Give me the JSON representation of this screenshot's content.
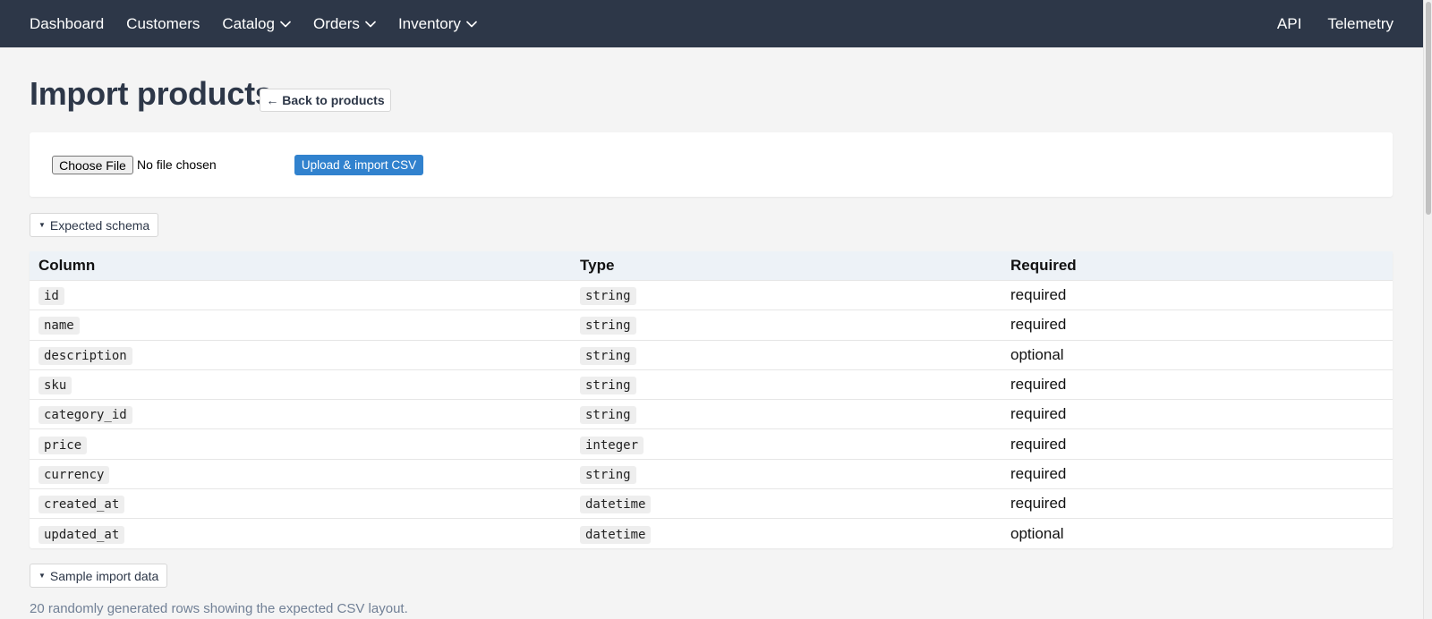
{
  "nav": {
    "left": [
      {
        "label": "Dashboard",
        "dropdown": false
      },
      {
        "label": "Customers",
        "dropdown": false
      },
      {
        "label": "Catalog",
        "dropdown": true
      },
      {
        "label": "Orders",
        "dropdown": true
      },
      {
        "label": "Inventory",
        "dropdown": true
      }
    ],
    "right": [
      {
        "label": "API"
      },
      {
        "label": "Telemetry"
      }
    ]
  },
  "page": {
    "title": "Import products",
    "back_label": "← Back to products"
  },
  "upload": {
    "choose_file_label": "Choose File",
    "file_status": "No file chosen",
    "submit_label": "Upload & import CSV"
  },
  "schema": {
    "toggle_label": "Expected schema",
    "headers": [
      "Column",
      "Type",
      "Required"
    ],
    "rows": [
      {
        "column": "id",
        "type": "string",
        "required": "required"
      },
      {
        "column": "name",
        "type": "string",
        "required": "required"
      },
      {
        "column": "description",
        "type": "string",
        "required": "optional"
      },
      {
        "column": "sku",
        "type": "string",
        "required": "required"
      },
      {
        "column": "category_id",
        "type": "string",
        "required": "required"
      },
      {
        "column": "price",
        "type": "integer",
        "required": "required"
      },
      {
        "column": "currency",
        "type": "string",
        "required": "required"
      },
      {
        "column": "created_at",
        "type": "datetime",
        "required": "required"
      },
      {
        "column": "updated_at",
        "type": "datetime",
        "required": "optional"
      }
    ]
  },
  "sample": {
    "toggle_label": "Sample import data",
    "helper_text": "20 randomly generated rows showing the expected CSV layout."
  },
  "colors": {
    "nav_bg": "#2d3748",
    "accent": "#3182ce",
    "table_header_bg": "#edf2f7"
  }
}
